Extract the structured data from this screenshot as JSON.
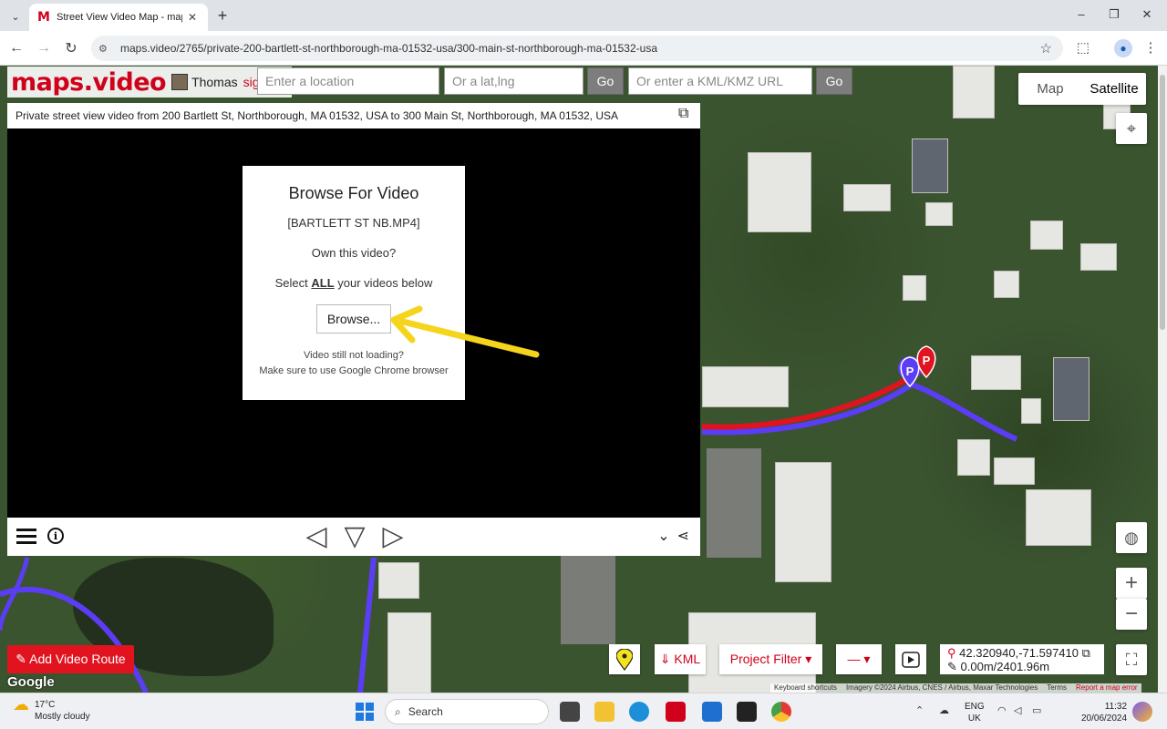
{
  "browser": {
    "tab_title": "Street View Video Map - maps.video",
    "tab_icon": "M",
    "url": "maps.video/2765/private-200-bartlett-st-northborough-ma-01532-usa/300-main-st-northborough-ma-01532-usa"
  },
  "header": {
    "logo": "maps.video",
    "username": "Thomas",
    "signout": "sign out",
    "location_placeholder": "Enter a location",
    "latlng_placeholder": "Or a lat,lng",
    "go_label": "Go",
    "kml_placeholder": "Or enter a KML/KMZ URL",
    "go2_label": "Go"
  },
  "maptype": {
    "map": "Map",
    "satellite": "Satellite"
  },
  "video": {
    "title": "Private street view video from 200 Bartlett St, Northborough, MA 01532, USA to 300 Main St, Northborough, MA 01532, USA",
    "dialog": {
      "title": "Browse For Video",
      "filename": "[BARTLETT ST NB.MP4]",
      "own": "Own this video?",
      "select_prefix": "Select ",
      "select_all": "ALL",
      "select_suffix": " your videos below",
      "browse": "Browse...",
      "help1": "Video still not loading?",
      "help2": "Make sure to use Google Chrome browser"
    }
  },
  "bottom": {
    "add_route": "✎ Add Video Route",
    "google": "Google",
    "kml": "⇓ KML",
    "project_filter": "Project Filter ▾",
    "dash": "— ▾",
    "lat_lng": "42.320940,-71.597410",
    "distance": "0.00m/2401.96m"
  },
  "attribution": {
    "shortcuts": "Keyboard shortcuts",
    "imagery": "Imagery ©2024 Airbus, CNES / Airbus, Maxar Technologies",
    "terms": "Terms",
    "report": "Report a map error"
  },
  "taskbar": {
    "temp": "17°C",
    "weather": "Mostly cloudy",
    "search": "Search",
    "lang1": "ENG",
    "lang2": "UK",
    "time": "11:32",
    "date": "20/06/2024"
  },
  "colors": {
    "brand": "#d0021b",
    "route_red": "#e0131f",
    "route_blue": "#5b3df5"
  }
}
